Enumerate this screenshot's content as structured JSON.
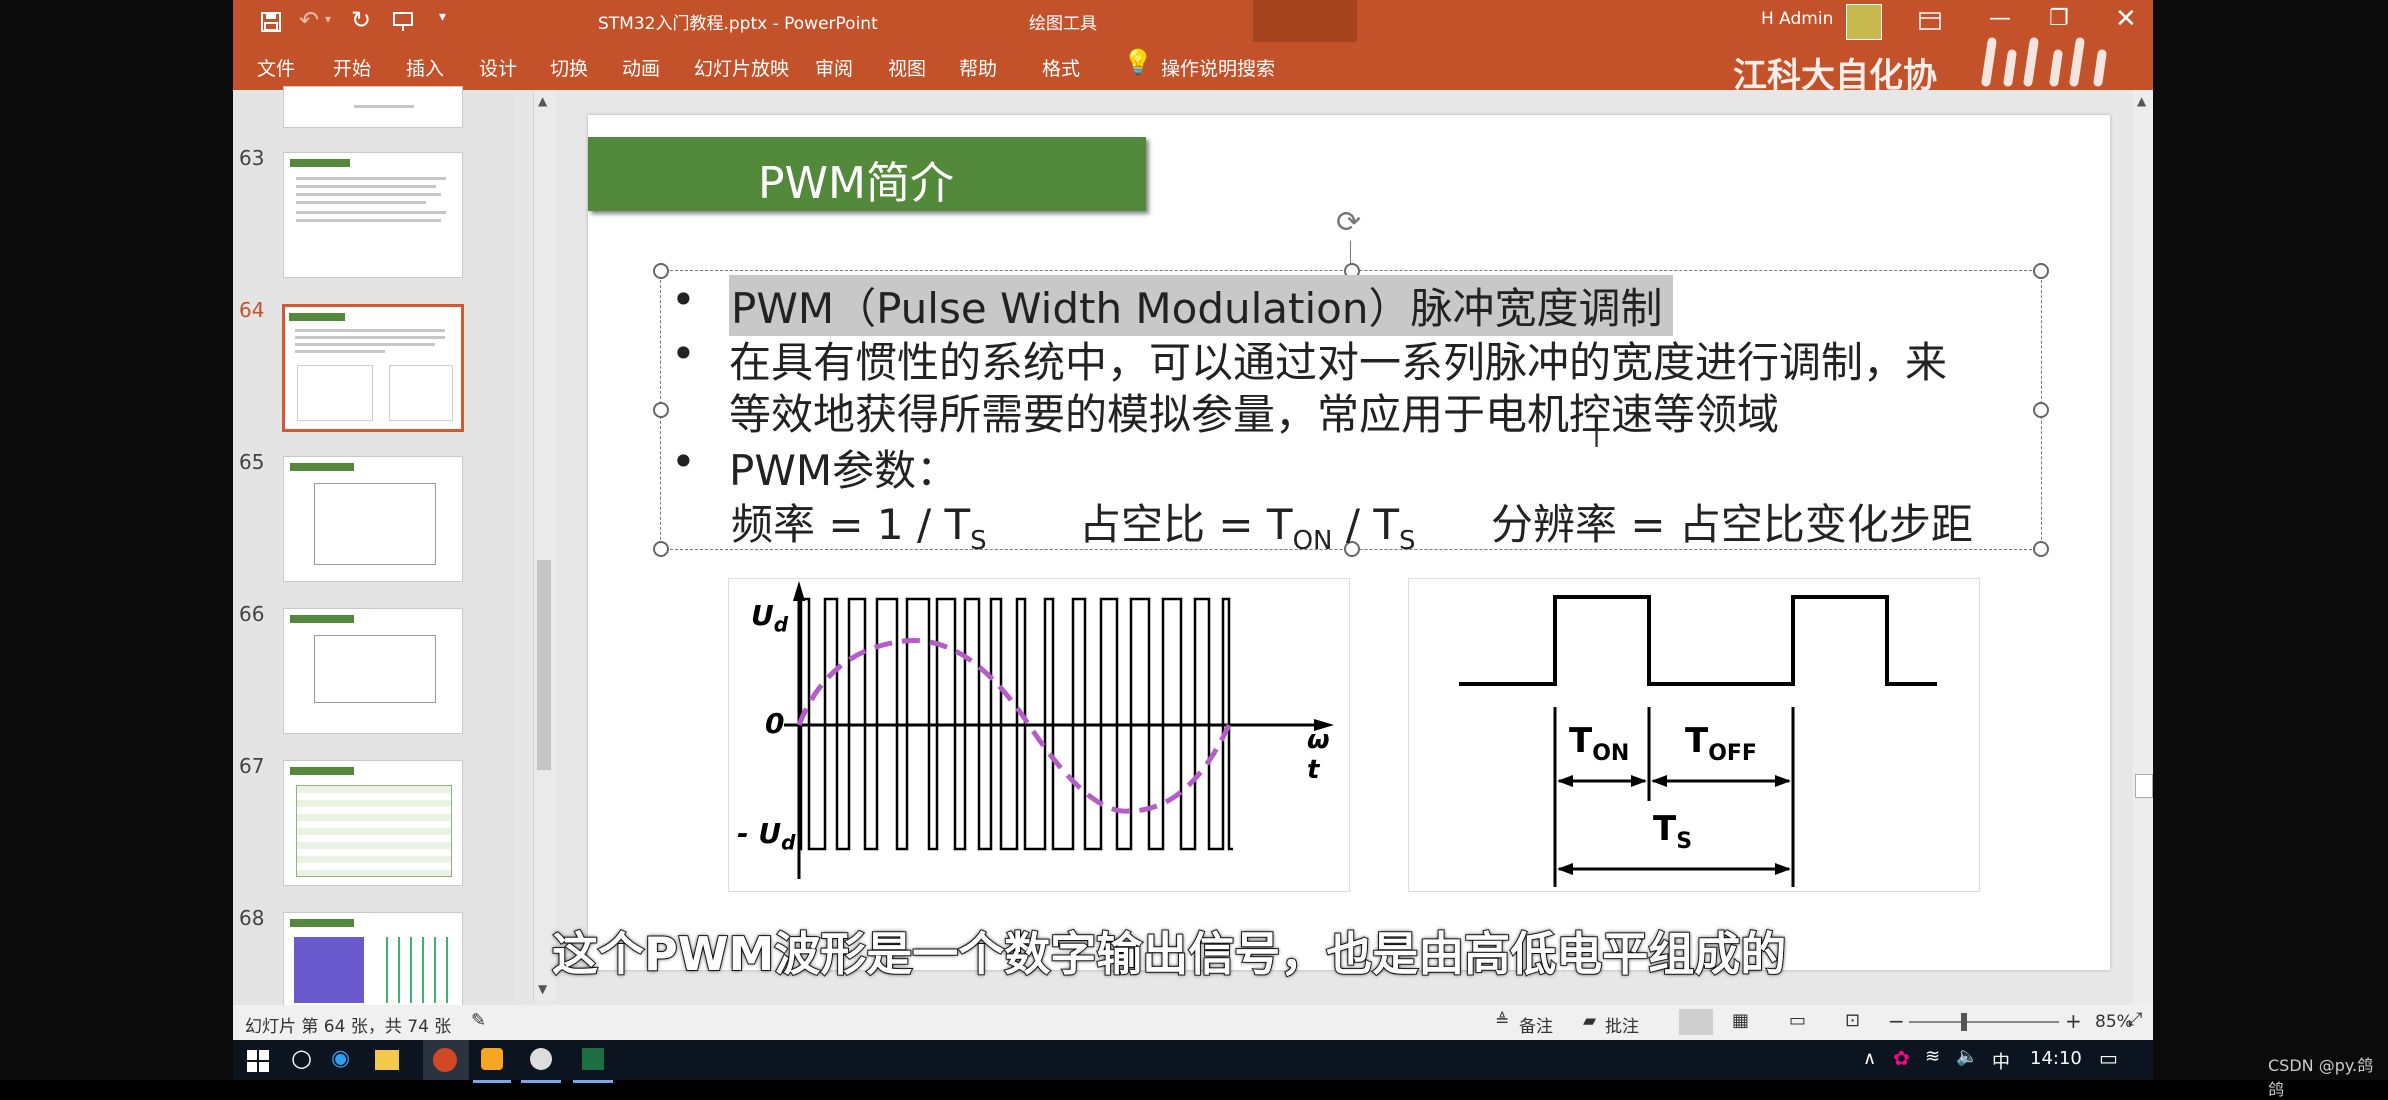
{
  "window": {
    "filename_title": "STM32入门教程.pptx  -  PowerPoint",
    "context_group": "绘图工具",
    "user": "H Admin",
    "watermark": "江科大自化协"
  },
  "ribbon": {
    "tabs": [
      "文件",
      "开始",
      "插入",
      "设计",
      "切换",
      "动画",
      "幻灯片放映",
      "审阅",
      "视图",
      "帮助",
      "格式"
    ],
    "tell_me": "操作说明搜索"
  },
  "thumbnails": [
    {
      "num": "63"
    },
    {
      "num": "64"
    },
    {
      "num": "65"
    },
    {
      "num": "66"
    },
    {
      "num": "67"
    },
    {
      "num": "68"
    }
  ],
  "slide": {
    "title": "PWM简介",
    "bullet1": "PWM（Pulse Width Modulation）脉冲宽度调制",
    "bullet2_line1": "在具有惯性的系统中，可以通过对一系列脉冲的宽度进行调制，来",
    "bullet2_line2": "等效地获得所需要的模拟参量，常应用于电机控速等领域",
    "bullet3": "PWM参数：",
    "param_freq": "频率 = 1 / T",
    "param_freq_sub": "S",
    "param_duty": "占空比 = T",
    "param_duty_sub1": "ON",
    "param_duty_mid": " / T",
    "param_duty_sub2": "S",
    "param_res": "分辨率 = 占空比变化步距",
    "fig1": {
      "ud_top": "U",
      "ud_top_sub": "d",
      "zero": "0",
      "ud_bot": "- U",
      "ud_bot_sub": "d",
      "wt": "ω t"
    },
    "fig2": {
      "ton": "T",
      "ton_sub": "ON",
      "toff": "T",
      "toff_sub": "OFF",
      "ts": "T",
      "ts_sub": "S"
    }
  },
  "subtitle": "这个PWM波形是一个数字输出信号，也是由高低电平组成的",
  "statusbar": {
    "slide_info": "幻灯片 第 64 张，共 74 张",
    "notes": "备注",
    "comments": "批注",
    "zoom": "85%"
  },
  "taskbar": {
    "ime": "中",
    "time": "14:10"
  },
  "corner_credit": "CSDN @py.鸽鸽",
  "colors": {
    "accent": "#c3522b",
    "title_green": "#53893a",
    "pwm_dash": "#b65cc8"
  }
}
